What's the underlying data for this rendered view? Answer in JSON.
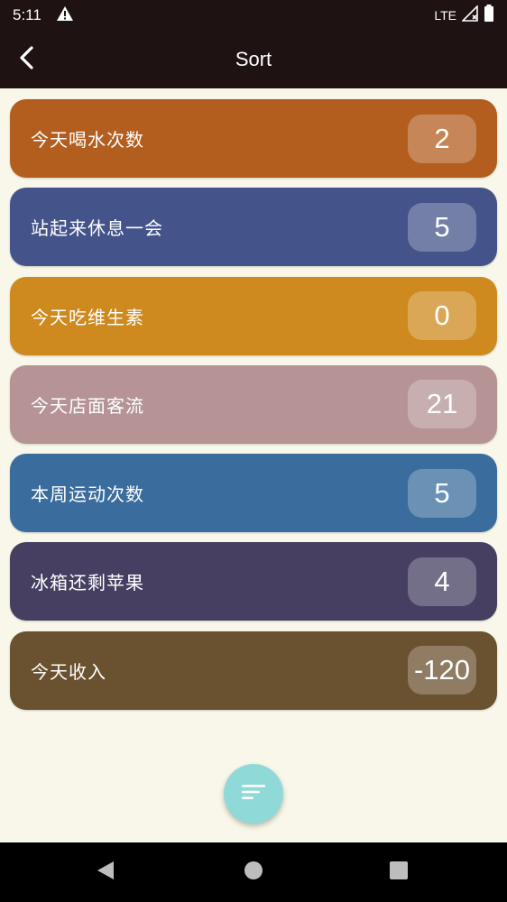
{
  "status_bar": {
    "time": "5:11",
    "network": "LTE"
  },
  "toolbar": {
    "title": "Sort"
  },
  "items": [
    {
      "label": "今天喝水次数",
      "count": "2",
      "color": "#B35E1F"
    },
    {
      "label": "站起来休息一会",
      "count": "5",
      "color": "#44548A"
    },
    {
      "label": "今天吃维生素",
      "count": "0",
      "color": "#CE8A1E"
    },
    {
      "label": "今天店面客流",
      "count": "21",
      "color": "#B69495"
    },
    {
      "label": "本周运动次数",
      "count": "5",
      "color": "#3A6C9D"
    },
    {
      "label": "冰箱还剩苹果",
      "count": "4",
      "color": "#463F62"
    },
    {
      "label": "今天收入",
      "count": "-120",
      "color": "#6A512F"
    }
  ],
  "colors": {
    "background": "#F8F7E9",
    "app_bar": "#1E1213",
    "fab": "#8FDAD8"
  },
  "icons": {
    "status": [
      "alert-icon",
      "signal-icon",
      "battery-icon"
    ],
    "toolbar": "back-arrow-icon",
    "fab": "sort-icon",
    "nav": [
      "nav-back-icon",
      "nav-home-icon",
      "nav-recents-icon"
    ]
  }
}
